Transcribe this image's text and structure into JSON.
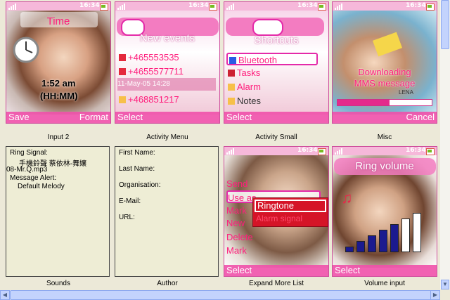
{
  "status": {
    "time": "16:34"
  },
  "panels": [
    {
      "id": "input2",
      "caption": "Input 2",
      "title": "Time",
      "time_value": "1:52 am",
      "time_format": "(HH:MM)",
      "left_soft": "Save",
      "right_soft": "Format"
    },
    {
      "id": "activity_menu",
      "caption": "Activity Menu",
      "title": "New events",
      "events": [
        "+465553535",
        "+4655577711",
        "11-May-05    14:28",
        "+468851217"
      ],
      "left_soft": "Select"
    },
    {
      "id": "activity_small",
      "caption": "Activity Small",
      "title": "Shortcuts",
      "items": [
        "Bluetooth",
        "Tasks",
        "Alarm",
        "Notes"
      ],
      "left_soft": "Select"
    },
    {
      "id": "misc",
      "caption": "Misc",
      "message": [
        "Downloading",
        "MMS message"
      ],
      "watermark": "LENA",
      "progress": 0.55,
      "right_soft": "Cancel"
    },
    {
      "id": "sounds",
      "caption": "Sounds",
      "lines": [
        "Ring Signal:",
        "手機鈴聲 蔡依林-舞孃",
        "08-Mr.Q.mp3",
        "Message Alert:",
        "Default Melody"
      ]
    },
    {
      "id": "author",
      "caption": "Author",
      "lines": [
        "First Name:",
        "Last Name:",
        "Organisation:",
        "E-Mail:",
        "URL:"
      ]
    },
    {
      "id": "expand_more_list",
      "caption": "Expand More List",
      "items": [
        "Send",
        "Use as",
        "Mark",
        "New",
        "Delete",
        "Mark"
      ],
      "submenu": [
        "Ringtone",
        "Alarm signal"
      ],
      "left_soft": "Select"
    },
    {
      "id": "volume_input",
      "caption": "Volume input",
      "title": "Ring volume",
      "level": 0.71,
      "left_soft": "Select"
    }
  ],
  "colors": {
    "pink": "#ff1d7c",
    "bar": "#f050aa",
    "volume_bar": "#1b1a8f",
    "submenu_bg": "#d51427"
  },
  "icons": [
    "signal-icon",
    "battery-icon",
    "clock-icon",
    "envelope-icon",
    "phone-icon",
    "bluetooth-icon",
    "bell-icon",
    "note-icon",
    "music-note-icon"
  ]
}
